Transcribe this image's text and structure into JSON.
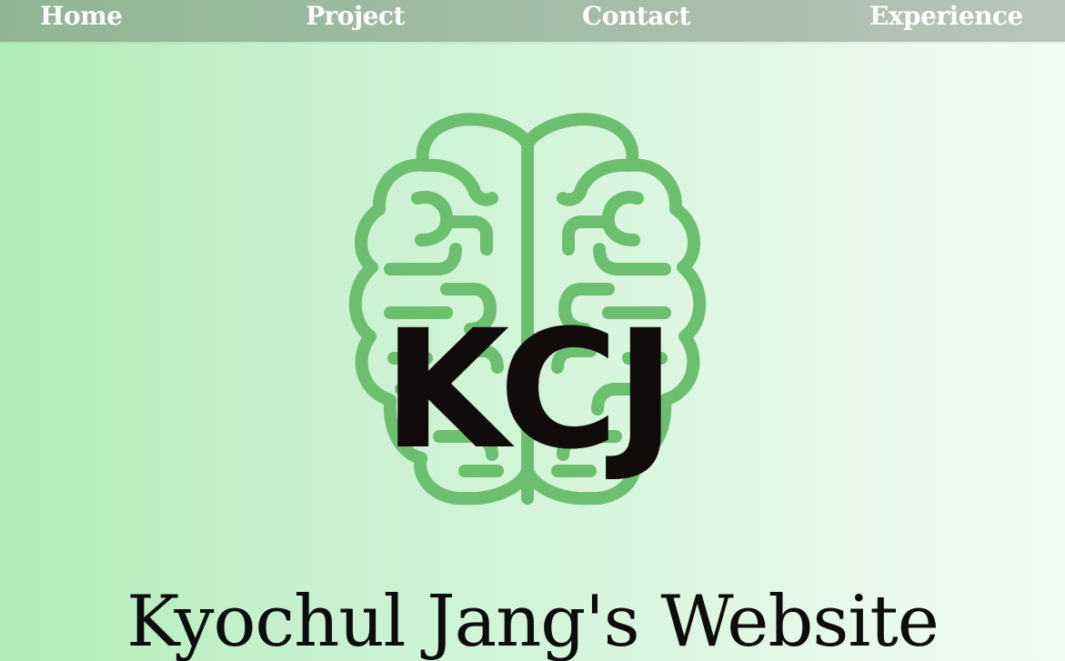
{
  "nav": {
    "home": "Home",
    "project": "Project",
    "contact": "Contact",
    "experience": "Experience"
  },
  "logo": {
    "icon": "brain-icon",
    "letters": "KCJ",
    "brain_color": "#6bbf6f",
    "letter_color": "#120b0b"
  },
  "page": {
    "title": "Kyochul Jang's Website"
  },
  "colors": {
    "navbar": "#a2bda5",
    "background_start": "#b2ecb8",
    "background_end": "#f2fbf4"
  }
}
